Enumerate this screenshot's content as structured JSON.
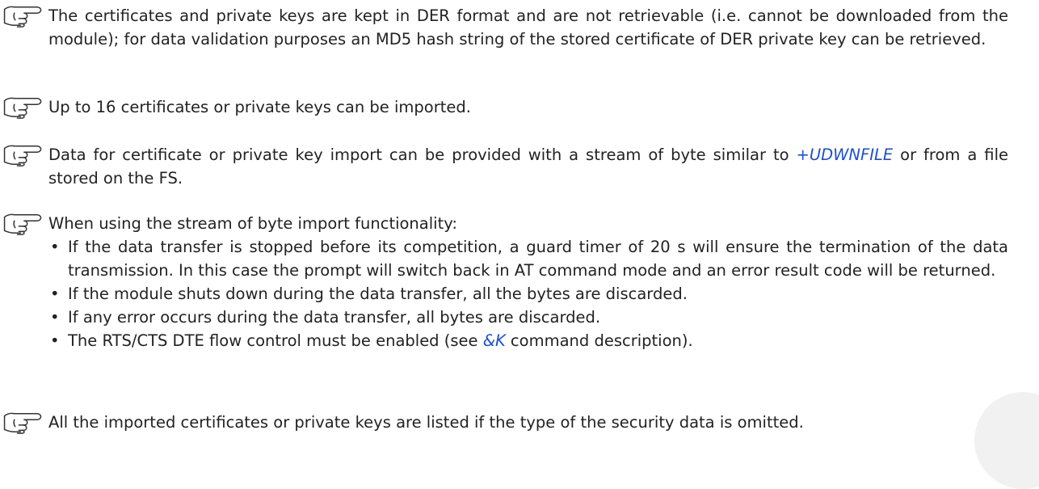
{
  "notes": [
    {
      "parts": [
        {
          "text": "The certificates and private keys are kept in DER format and are not retrievable (i.e. cannot be downloaded from the module); for data validation purposes an MD5 hash string of the stored certificate of DER private key can be retrieved."
        }
      ]
    },
    {
      "parts": [
        {
          "text": "Up to 16 certificates or private keys can be imported."
        }
      ]
    },
    {
      "parts": [
        {
          "text": "Data for certificate or private key import can be provided with a stream of byte similar to "
        },
        {
          "text": "+UDWNFILE",
          "link": true
        },
        {
          "text": " or from a file stored on the FS."
        }
      ]
    },
    {
      "intro": "When using the stream of byte import functionality:",
      "bullets": [
        "If the data transfer is stopped before its competition, a guard timer of 20 s will ensure the termination of the data transmission. In this case the prompt will switch back in AT command mode and an error result code will be returned.",
        "If the module shuts down during the data transfer, all the bytes are discarded.",
        "If any error occurs during the data transfer, all bytes are discarded."
      ],
      "last_bullet": {
        "before": "The RTS/CTS DTE flow control must be enabled (see ",
        "link": "&K",
        "after": " command description)."
      }
    },
    {
      "parts": [
        {
          "text": "All the imported certificates or private keys are listed if the type of the security data is omitted."
        }
      ]
    }
  ],
  "icons": {
    "note_icon": "pointing-hand-icon"
  },
  "colors": {
    "text": "#222222",
    "link": "#1a4fd8"
  },
  "bullet_char": "•"
}
